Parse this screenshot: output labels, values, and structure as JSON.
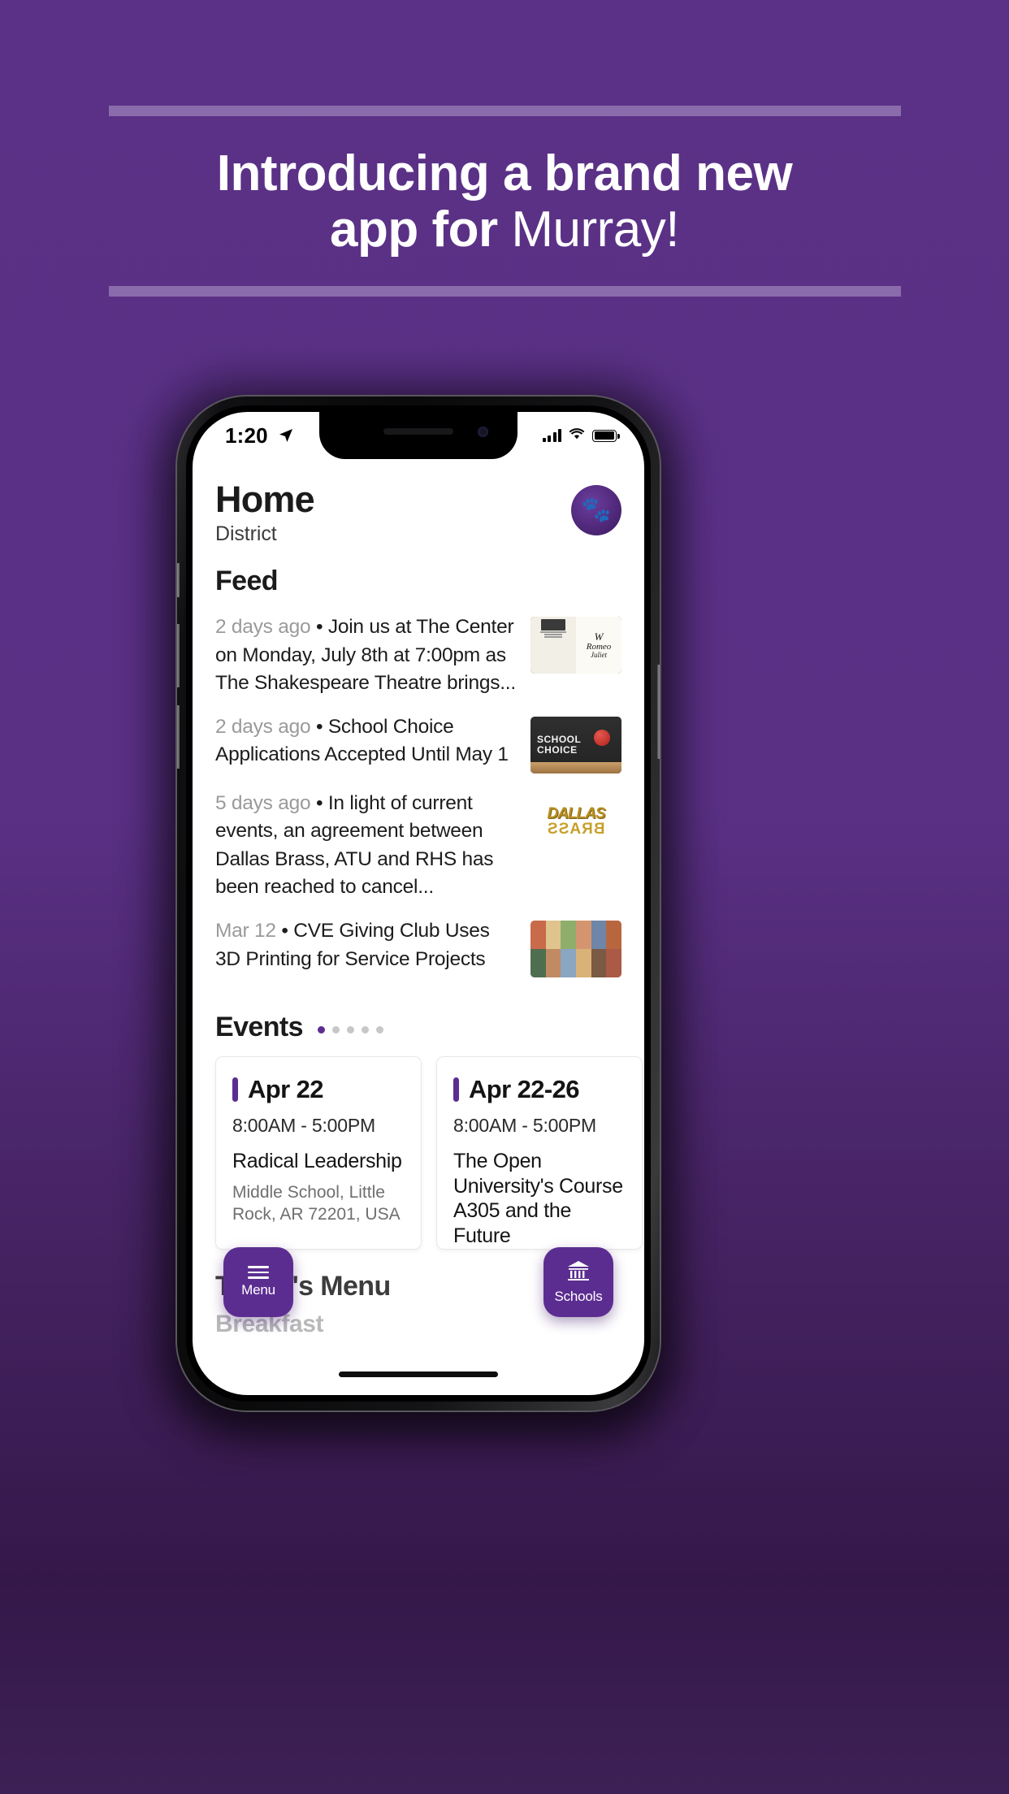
{
  "promo": {
    "line1_bold": "Introducing a brand new",
    "line2_bold": "app for",
    "line2_light": " Murray!"
  },
  "colors": {
    "background_purple": "#5b3187",
    "rule_purple": "#8a6cac",
    "accent": "#5c2d91",
    "dot_inactive": "#c7c7c7"
  },
  "phone": {
    "statusbar": {
      "time": "1:20",
      "location_icon": "location-arrow-icon",
      "signal_icon": "cellular-bars-icon",
      "wifi_icon": "wifi-icon",
      "battery_icon": "battery-full-icon"
    },
    "header": {
      "title": "Home",
      "subtitle": "District",
      "avatar_icon": "school-mascot-avatar"
    },
    "feed": {
      "heading": "Feed",
      "items": [
        {
          "date": "2 days ago",
          "separator": "•",
          "text": "Join us at The Center on Monday, July 8th at 7:00pm as The Shakespeare Theatre brings...",
          "thumb_icon": "shakespeare-flyer-thumbnail",
          "thumb_labels": {
            "panel1_line1": "THE CENTER",
            "panel1_line2": "July 8, 2019",
            "panel1_line3": "7:00 PM",
            "panel1_line4": "General Admission",
            "panel1_line5": "$15.00",
            "panel2_line1": "W",
            "panel2_line2": "Romeo",
            "panel2_line3": "and",
            "panel2_line4": "Juliet"
          }
        },
        {
          "date": "2 days ago",
          "separator": "•",
          "text": "School Choice Applications Accepted Until May 1",
          "thumb_icon": "school-choice-chalkboard-thumbnail",
          "thumb_labels": {
            "line1": "SCHOOL",
            "line2": "CHOICE"
          }
        },
        {
          "date": "5 days ago",
          "separator": "•",
          "text": "In light of current events, an agreement between Dallas Brass, ATU and RHS has been reached to cancel...",
          "thumb_icon": "dallas-brass-logo-thumbnail",
          "thumb_labels": {
            "line1": "DALLAS",
            "line2": "BRASS"
          }
        },
        {
          "date": "Mar 12",
          "separator": "•",
          "text": "CVE Giving Club Uses 3D Printing for Service Projects",
          "thumb_icon": "students-photo-thumbnail",
          "thumb_labels": {}
        }
      ]
    },
    "events": {
      "heading": "Events",
      "pager": {
        "total": 5,
        "active_index": 0
      },
      "cards": [
        {
          "date": "Apr 22",
          "time": "8:00AM  -  5:00PM",
          "name": "Radical Leadership",
          "location": "Middle School, Little Rock, AR 72201, USA"
        },
        {
          "date": "Apr 22-26",
          "time": "8:00AM  -  5:00PM",
          "name": "The Open University's Course A305 and the Future",
          "location": ""
        }
      ]
    },
    "menu": {
      "heading": "Today's Menu",
      "subheading": "Breakfast"
    },
    "fab_left": {
      "label": "Menu",
      "icon": "hamburger-menu-icon"
    },
    "fab_right": {
      "label": "Schools",
      "icon": "school-building-icon"
    }
  }
}
